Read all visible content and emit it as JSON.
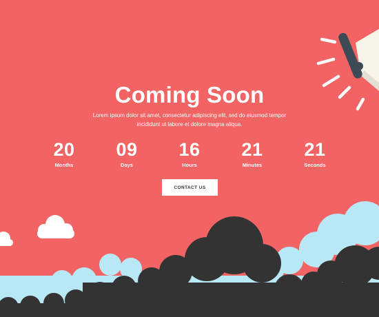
{
  "hero": {
    "title": "Coming Soon",
    "subtitle": "Lorem ipsum dolor sit amet, consectetur adipiscing elit, sed do eiusmod tempor incididunt ut labore et dolore magna aliqua."
  },
  "countdown": [
    {
      "value": "20",
      "label": "Months"
    },
    {
      "value": "09",
      "label": "Days"
    },
    {
      "value": "16",
      "label": "Hours"
    },
    {
      "value": "21",
      "label": "Minutes"
    },
    {
      "value": "21",
      "label": "Seconds"
    }
  ],
  "cta": {
    "label": "CONTACT US"
  },
  "colors": {
    "background": "#f26363",
    "cloud_dark": "#333333",
    "cloud_light": "#b8e8f5",
    "cloud_white": "#ffffff",
    "text": "#ffffff"
  },
  "icons": {
    "megaphone": "megaphone-icon"
  }
}
